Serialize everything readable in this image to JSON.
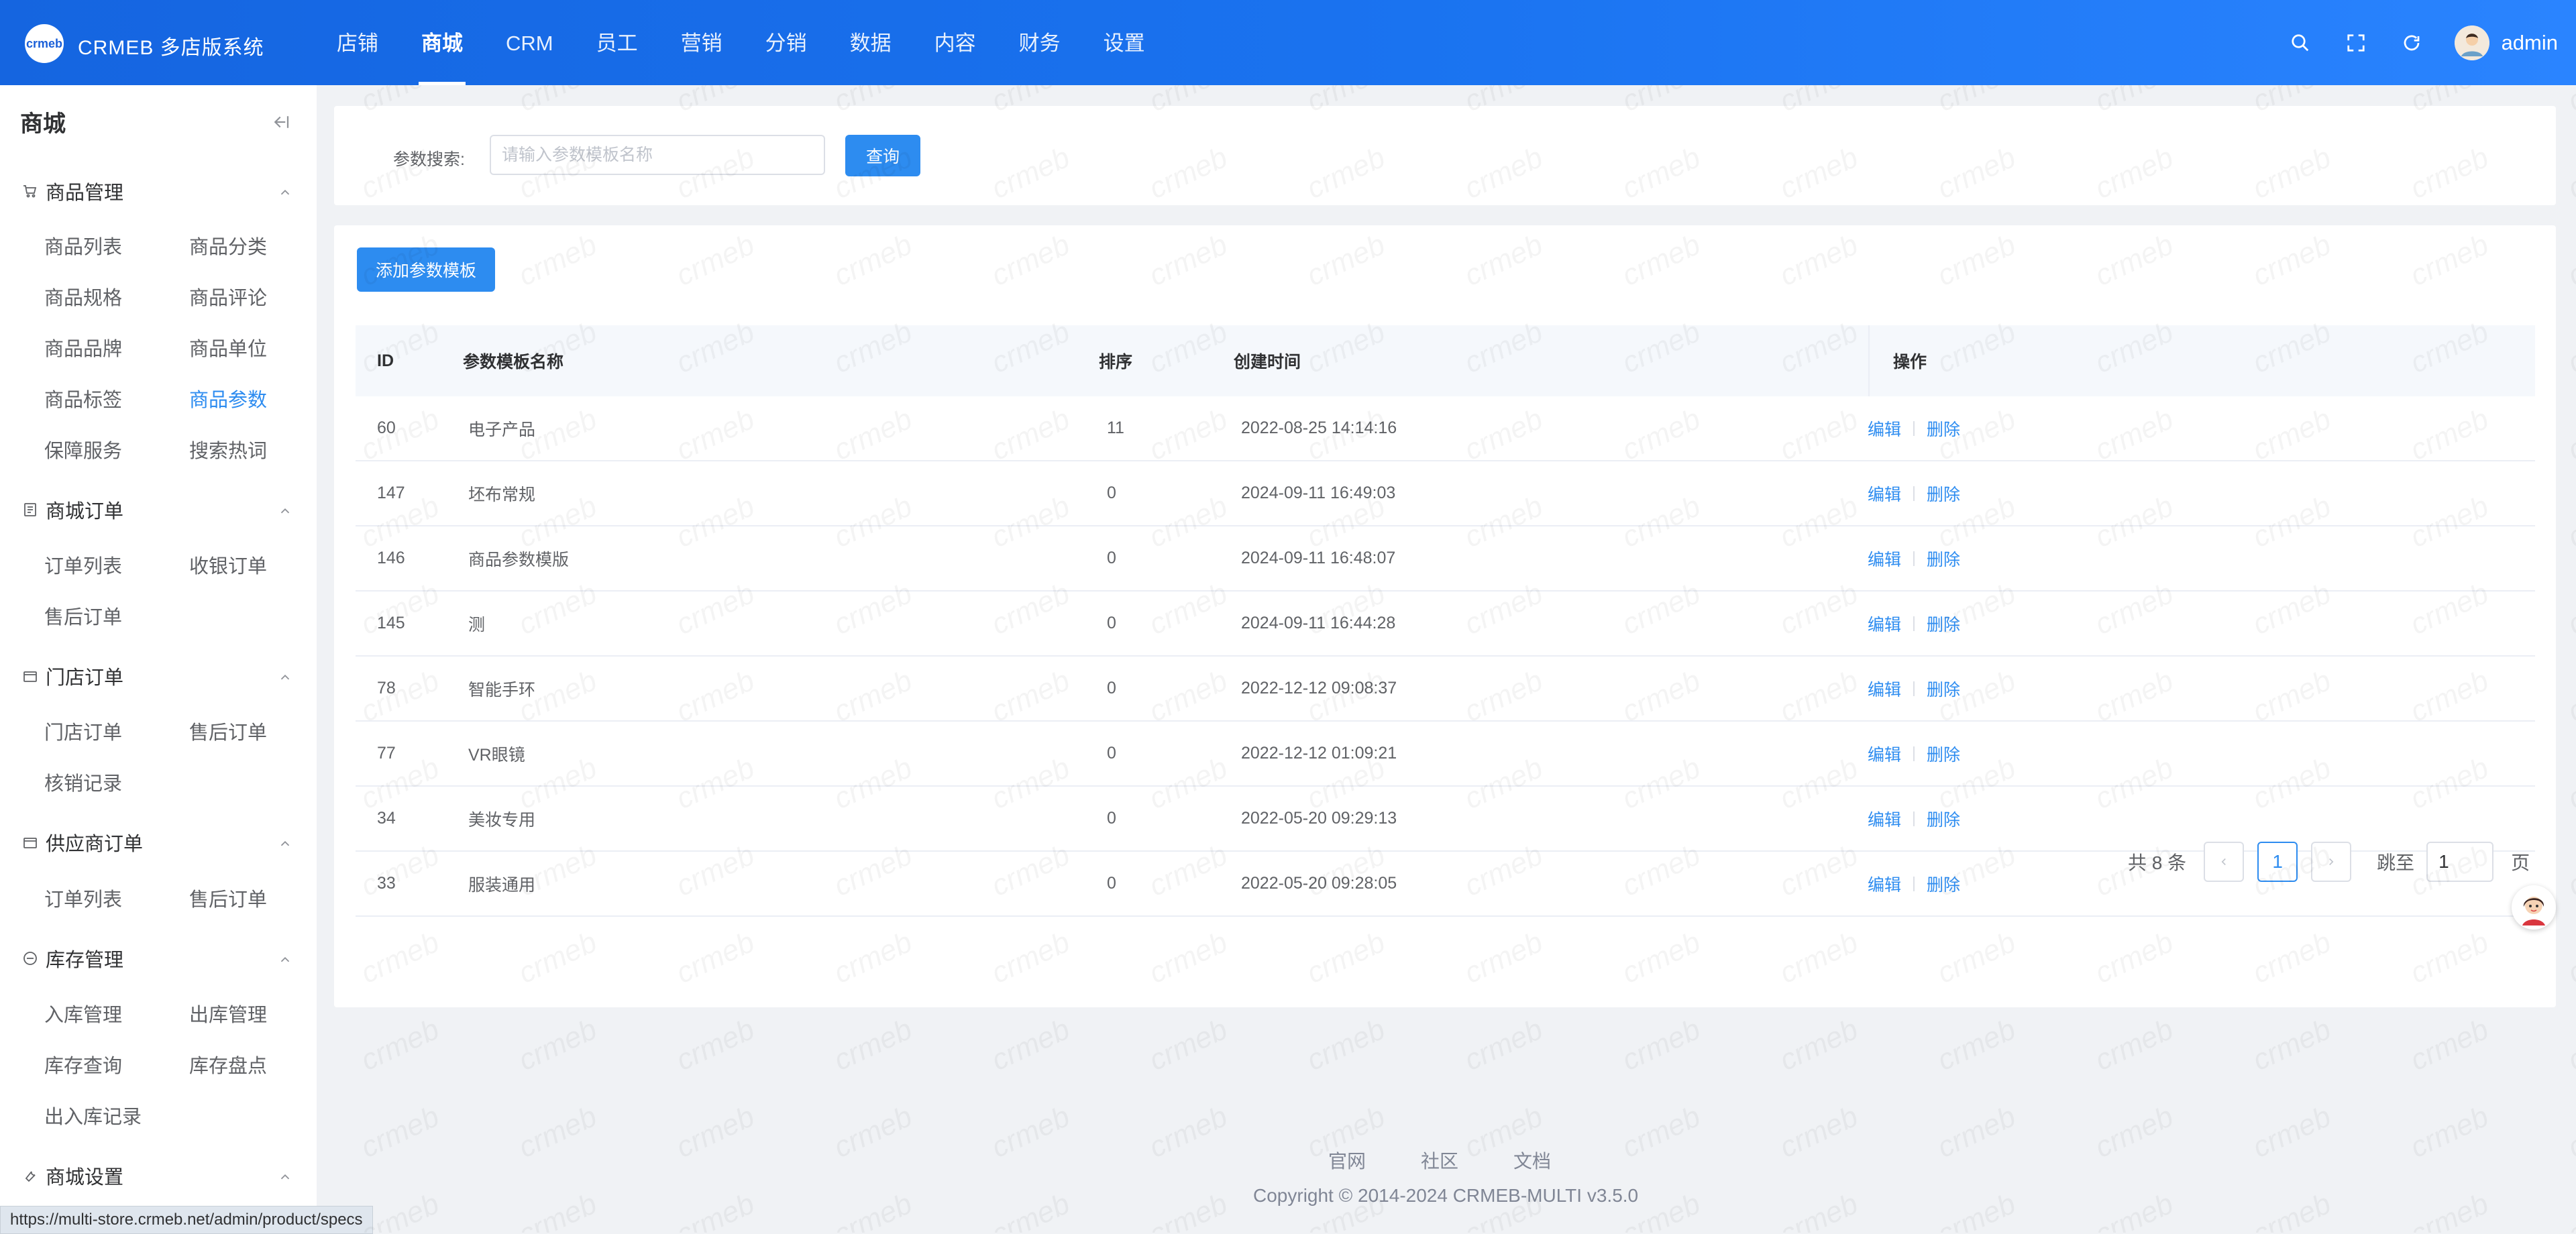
{
  "brand": {
    "logo_text": "crmeb",
    "title": "CRMEB 多店版系统"
  },
  "nav": {
    "items": [
      {
        "label": "店铺"
      },
      {
        "label": "商城"
      },
      {
        "label": "CRM"
      },
      {
        "label": "员工"
      },
      {
        "label": "营销"
      },
      {
        "label": "分销"
      },
      {
        "label": "数据"
      },
      {
        "label": "内容"
      },
      {
        "label": "财务"
      },
      {
        "label": "设置"
      }
    ],
    "active": "商城"
  },
  "user": {
    "name": "admin"
  },
  "sidebar": {
    "title": "商城",
    "groups": [
      {
        "label": "商品管理",
        "items": [
          "商品列表",
          "商品分类",
          "商品规格",
          "商品评论",
          "商品品牌",
          "商品单位",
          "商品标签",
          "商品参数",
          "保障服务",
          "搜索热词"
        ]
      },
      {
        "label": "商城订单",
        "items": [
          "订单列表",
          "收银订单",
          "售后订单"
        ]
      },
      {
        "label": "门店订单",
        "items": [
          "门店订单",
          "售后订单",
          "核销记录"
        ]
      },
      {
        "label": "供应商订单",
        "items": [
          "订单列表",
          "售后订单"
        ]
      },
      {
        "label": "库存管理",
        "items": [
          "入库管理",
          "出库管理",
          "库存查询",
          "库存盘点",
          "出入库记录"
        ]
      },
      {
        "label": "商城设置",
        "items": []
      }
    ],
    "active_item": "商品参数"
  },
  "search": {
    "label": "参数搜索:",
    "placeholder": "请输入参数模板名称",
    "button": "查询"
  },
  "actions": {
    "add_button": "添加参数模板"
  },
  "table": {
    "headers": {
      "id": "ID",
      "name": "参数模板名称",
      "sort": "排序",
      "time": "创建时间",
      "op": "操作"
    },
    "rows": [
      {
        "id": "60",
        "name": "电子产品",
        "sort": "11",
        "time": "2022-08-25 14:14:16"
      },
      {
        "id": "147",
        "name": "坯布常规",
        "sort": "0",
        "time": "2024-09-11 16:49:03"
      },
      {
        "id": "146",
        "name": "商品参数模版",
        "sort": "0",
        "time": "2024-09-11 16:48:07"
      },
      {
        "id": "145",
        "name": "测",
        "sort": "0",
        "time": "2024-09-11 16:44:28"
      },
      {
        "id": "78",
        "name": "智能手环",
        "sort": "0",
        "time": "2022-12-12 09:08:37"
      },
      {
        "id": "77",
        "name": "VR眼镜",
        "sort": "0",
        "time": "2022-12-12 01:09:21"
      },
      {
        "id": "34",
        "name": "美妆专用",
        "sort": "0",
        "time": "2022-05-20 09:29:13"
      },
      {
        "id": "33",
        "name": "服装通用",
        "sort": "0",
        "time": "2022-05-20 09:28:05"
      }
    ],
    "edit_label": "编辑",
    "delete_label": "删除"
  },
  "pagination": {
    "total_text": "共 8 条",
    "current_page": "1",
    "goto_label": "跳至",
    "goto_value": "1",
    "page_unit": "页"
  },
  "footer": {
    "links": [
      "官网",
      "社区",
      "文档"
    ],
    "copyright": "Copyright © 2014-2024 CRMEB-MULTI v3.5.0"
  },
  "status_bar": {
    "url": "https://multi-store.crmeb.net/admin/product/specs"
  },
  "watermark_text": "crmeb",
  "colors": {
    "primary": "#2d8cf0",
    "topbar": "#1a6ff0"
  }
}
